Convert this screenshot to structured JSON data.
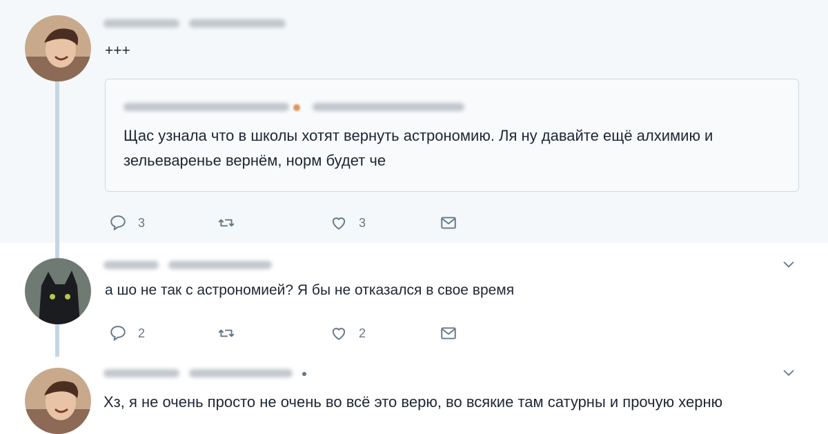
{
  "tweets": [
    {
      "text": "+++",
      "quote": {
        "text": "Щас узнала что в школы хотят вернуть астрономию. Ля ну давайте ещё алхимию и зельеваренье вернём, норм будет че"
      },
      "actions": {
        "reply_count": "3",
        "like_count": "3"
      }
    },
    {
      "text": "а шо не так  с астрономией? Я бы не отказался в свое время",
      "actions": {
        "reply_count": "2",
        "like_count": "2"
      }
    },
    {
      "text": "Хз, я не очень просто не очень во всё это верю, во всякие там сатурны и прочую херню"
    }
  ],
  "icons": {
    "reply": "reply-icon",
    "retweet": "retweet-icon",
    "like": "heart-icon",
    "dm": "envelope-icon",
    "menu": "chevron-down-icon"
  },
  "colors": {
    "panel": "#f5f8fa",
    "thread_line": "#c5d6e3",
    "icon": "#657786",
    "text": "#1c2733"
  }
}
